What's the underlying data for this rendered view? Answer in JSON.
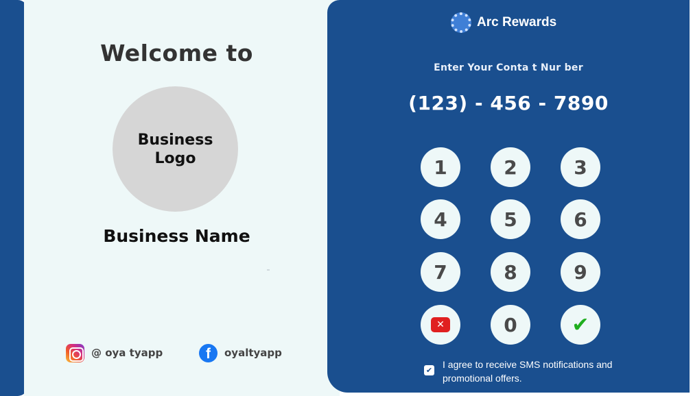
{
  "left": {
    "welcome": "Welcome to",
    "logo_placeholder": "Business\nLogo",
    "business_name": "Business Name",
    "instagram_handle": "@ oya tyapp",
    "facebook_handle": "oyaltyapp"
  },
  "brand": {
    "name": "Arc Rewards",
    "icon": "arc-rewards-logo-icon"
  },
  "phone_entry": {
    "prompt": "Enter Your Conta t Nur ber",
    "value": "(123) - 456 - 7890"
  },
  "keypad": {
    "keys": [
      "1",
      "2",
      "3",
      "4",
      "5",
      "6",
      "7",
      "8",
      "9",
      "0"
    ],
    "delete_icon": "backspace-icon",
    "submit_icon": "checkmark-icon"
  },
  "consent": {
    "checked": true,
    "text": "I agree to receive SMS notifications and promotional offers."
  },
  "colors": {
    "primary_blue": "#1a4f8f",
    "panel_light": "#eef8f8",
    "delete_red": "#e02020",
    "submit_green": "#1fae1f"
  }
}
